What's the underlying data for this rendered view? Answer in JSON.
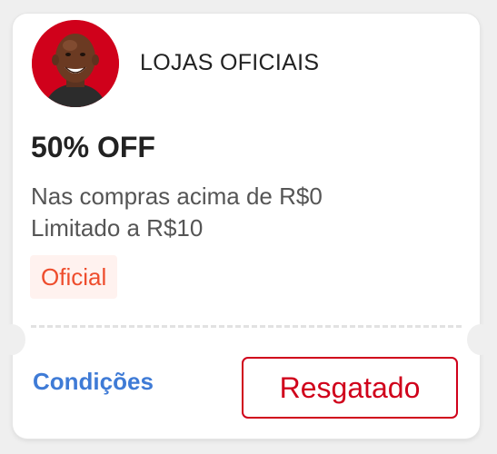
{
  "coupon": {
    "store_name": "LOJAS OFICIAIS",
    "discount": "50% OFF",
    "min_spend": "Nas compras acima de R$0",
    "cap": "Limitado a R$10",
    "tag": "Oficial",
    "conditions_link": "Condições",
    "claim_button": "Resgatado"
  },
  "colors": {
    "brand_red": "#d0011b",
    "tag_text": "#ee4d2d",
    "tag_bg": "#fff2ef",
    "link_blue": "#3f7bd6"
  },
  "icons": {
    "avatar": "store-avatar-photo"
  }
}
